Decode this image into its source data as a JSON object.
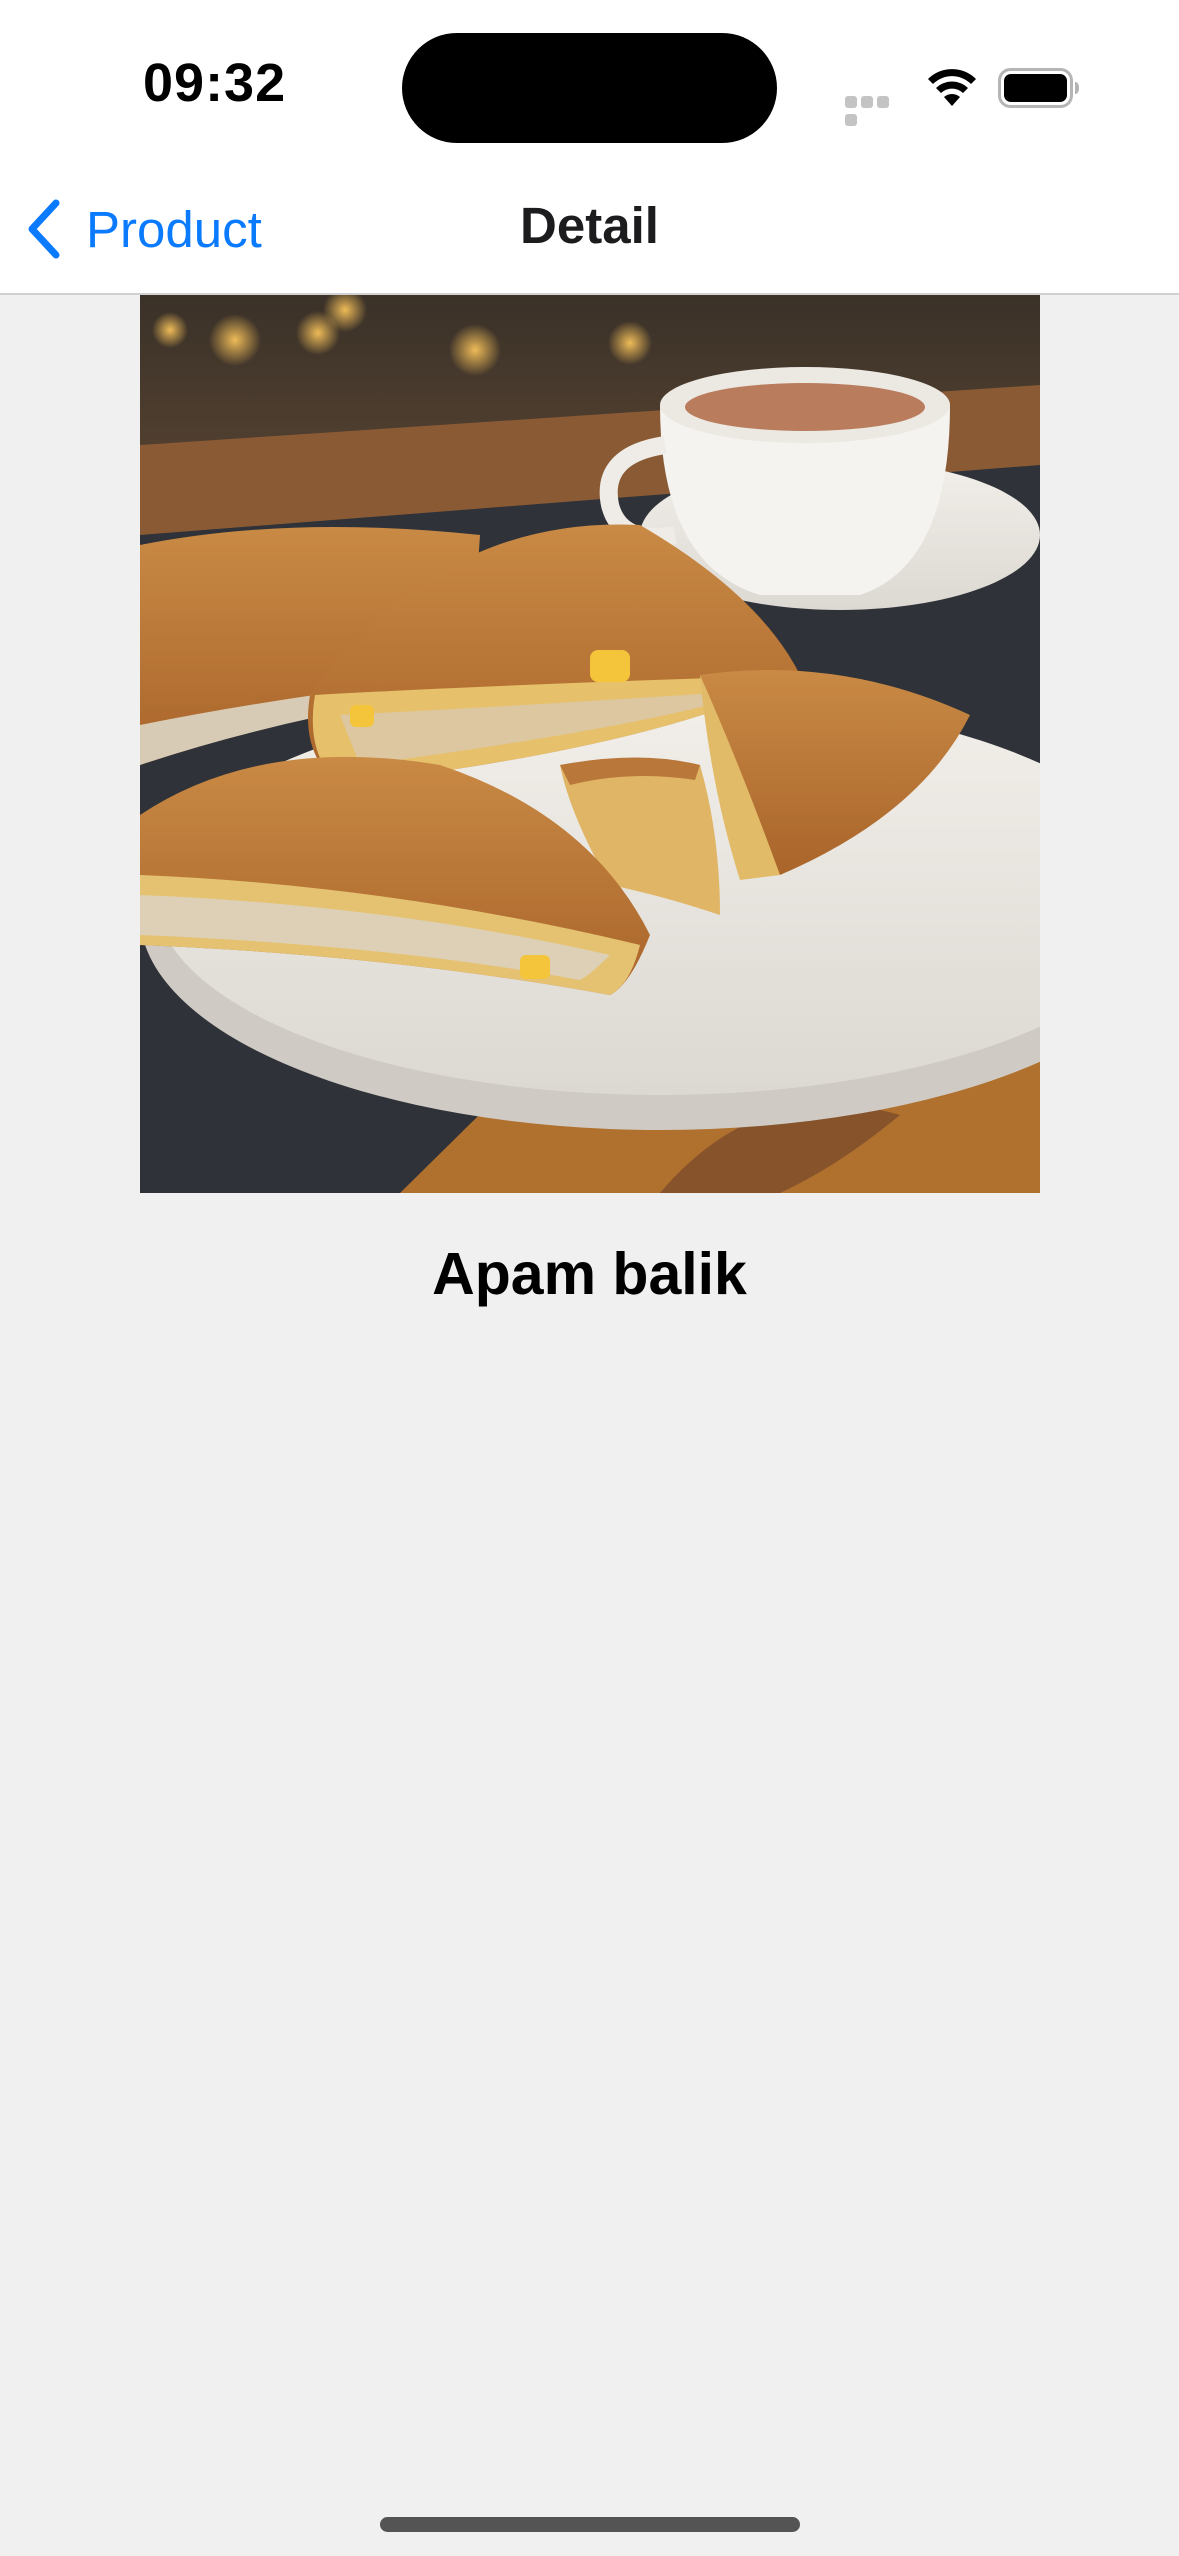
{
  "status_bar": {
    "time": "09:32",
    "icons": [
      "signal-dots-icon",
      "wifi-icon",
      "battery-icon"
    ]
  },
  "nav": {
    "back_label": "Product",
    "back_icon": "chevron-left-icon",
    "title": "Detail",
    "accent_color": "#0a7aff"
  },
  "product": {
    "name": "Apam balik",
    "image_alt": "Apam balik"
  },
  "colors": {
    "background": "#f0f0f0",
    "bar_background": "#ffffff",
    "accent": "#0a7aff"
  }
}
